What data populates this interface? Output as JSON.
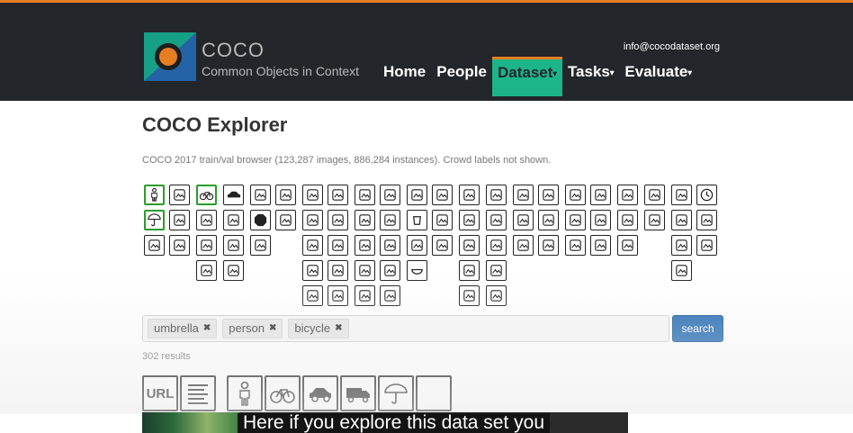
{
  "header": {
    "logo_title": "COCO",
    "logo_subtitle": "Common Objects in Context",
    "email": "info@cocodataset.org",
    "nav": [
      {
        "label": "Home",
        "dropdown": false,
        "active": false
      },
      {
        "label": "People",
        "dropdown": false,
        "active": false
      },
      {
        "label": "Dataset",
        "dropdown": true,
        "active": true
      },
      {
        "label": "Tasks",
        "dropdown": true,
        "active": false
      },
      {
        "label": "Evaluate",
        "dropdown": true,
        "active": false
      }
    ],
    "colors": {
      "bar": "#23272b",
      "accent": "#e67e22",
      "active": "#1cb58a"
    }
  },
  "main": {
    "title": "COCO Explorer",
    "description": "COCO 2017 train/val browser (123,287 images, 886,284 instances). Crowd labels not shown."
  },
  "categories": {
    "selected": [
      "person",
      "bicycle",
      "umbrella"
    ],
    "icons": [
      "person",
      "bicycle",
      "car",
      "motorcycle",
      "airplane",
      "bus",
      "train",
      "truck",
      "boat",
      "traffic light",
      "fire hydrant",
      "stop sign",
      "parking meter",
      "bench",
      "bird",
      "cat",
      "dog",
      "horse",
      "sheep",
      "cow",
      "elephant",
      "bear",
      "zebra",
      "giraffe",
      "backpack",
      "umbrella",
      "handbag",
      "tie",
      "suitcase",
      "frisbee",
      "skis",
      "snowboard",
      "sports ball",
      "kite",
      "baseball bat",
      "baseball glove",
      "skateboard",
      "surfboard",
      "tennis racket",
      "bottle",
      "wine glass",
      "cup",
      "fork",
      "knife",
      "spoon",
      "bowl",
      "banana",
      "apple",
      "sandwich",
      "orange",
      "broccoli",
      "carrot",
      "hot dog",
      "pizza",
      "donut",
      "cake",
      "chair",
      "couch",
      "potted plant",
      "bed",
      "dining table",
      "toilet",
      "tv",
      "laptop",
      "mouse",
      "remote",
      "keyboard",
      "cell phone",
      "microwave",
      "oven",
      "toaster",
      "sink",
      "refrigerator",
      "book",
      "clock",
      "vase",
      "scissors",
      "teddy bear",
      "hair drier",
      "toothbrush"
    ]
  },
  "search": {
    "tags": [
      {
        "label": "umbrella",
        "remove": "✖"
      },
      {
        "label": "person",
        "remove": "✖"
      },
      {
        "label": "bicycle",
        "remove": "✖"
      }
    ],
    "button_label": "search",
    "button_color": "#2a6fb5"
  },
  "results": {
    "count_text": "302 results",
    "url_label": "URL",
    "toolbar_icons": [
      "url",
      "captions-icon",
      "person-icon",
      "bicycle-icon",
      "car-icon",
      "truck-icon",
      "umbrella-icon",
      "empty"
    ]
  },
  "caption": "Here if you explore this data set you"
}
